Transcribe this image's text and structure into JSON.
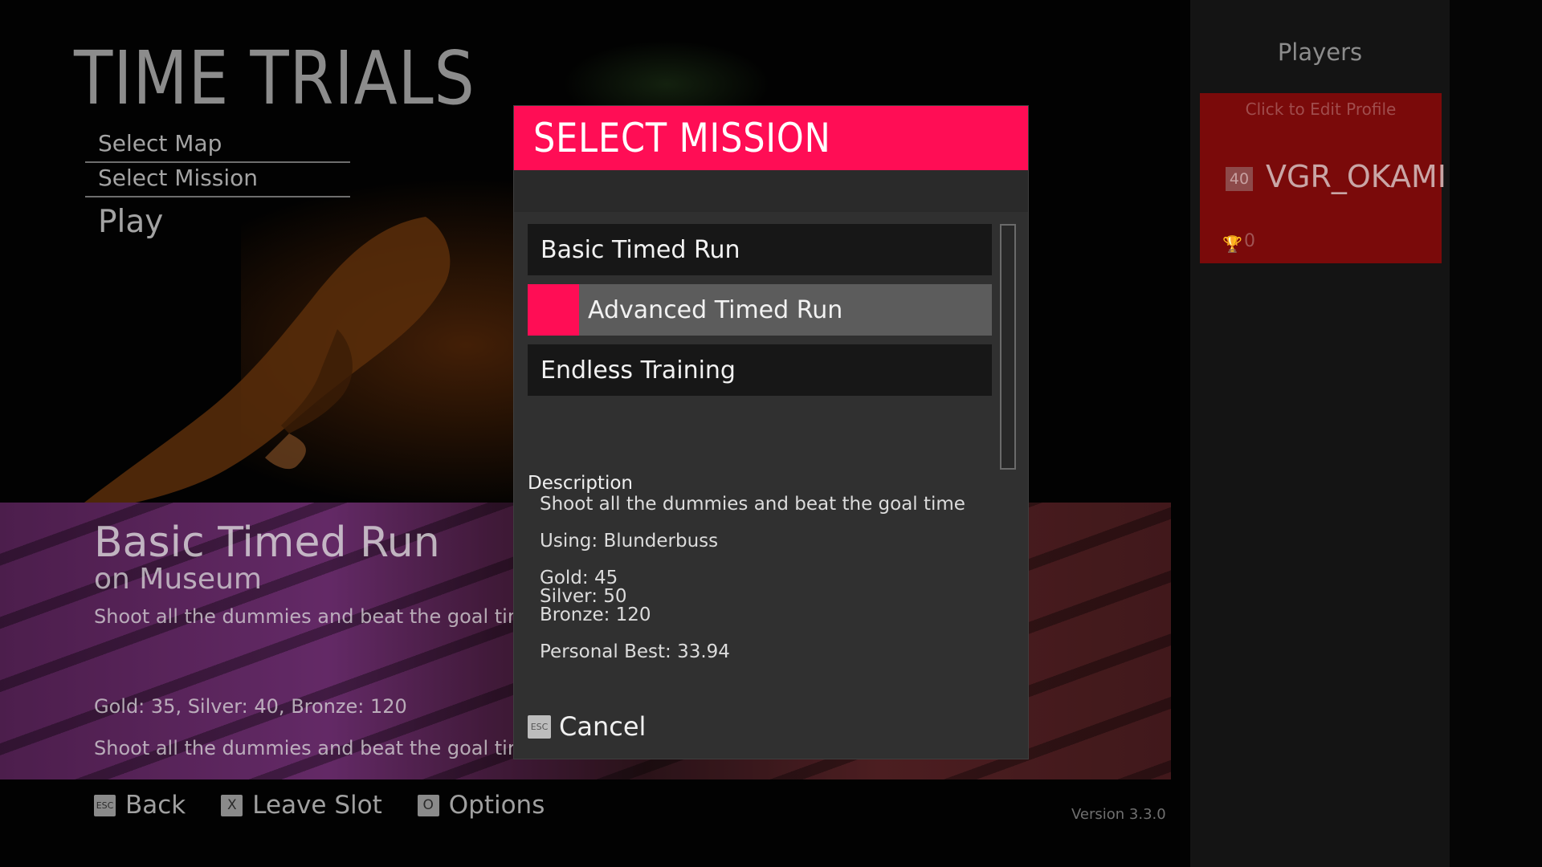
{
  "app": {
    "title": "TIME TRIALS",
    "version": "Version 3.3.0"
  },
  "menu": {
    "items": [
      {
        "label": "Select Map"
      },
      {
        "label": "Select Mission"
      },
      {
        "label": "Play"
      }
    ]
  },
  "info_band": {
    "title": "Basic Timed Run",
    "subtitle": "on Museum",
    "description": "Shoot all the dummies and beat the goal tim",
    "medals": "Gold: 35, Silver: 40, Bronze: 120",
    "description_repeat": "Shoot all the dummies and beat the goal tim"
  },
  "hints": [
    {
      "key": "ESC",
      "label": "Back",
      "icon": "esc-key-icon"
    },
    {
      "key": "X",
      "label": "Leave Slot",
      "icon": "x-key-icon"
    },
    {
      "key": "O",
      "label": "Options",
      "icon": "o-key-icon"
    }
  ],
  "players": {
    "title": "Players",
    "profile": {
      "hint": "Click to Edit Profile",
      "level": "40",
      "name": "VGR_OKAMI",
      "trophies": "0",
      "trophy_icon": "trophy-icon",
      "color": "#7a0a0a"
    }
  },
  "modal": {
    "title": "SELECT MISSION",
    "accent": "#ff0d55",
    "missions": [
      {
        "label": "Basic Timed Run",
        "selected": false
      },
      {
        "label": "Advanced Timed Run",
        "selected": true
      },
      {
        "label": "Endless Training",
        "selected": false
      }
    ],
    "description_label": "Description",
    "description": "Shoot all the dummies and beat the goal time",
    "using": "Using: Blunderbuss",
    "gold": "Gold: 45",
    "silver": "Silver: 50",
    "bronze": "Bronze: 120",
    "personal_best": "Personal Best: 33.94",
    "cancel_key": "ESC",
    "cancel_label": "Cancel"
  }
}
